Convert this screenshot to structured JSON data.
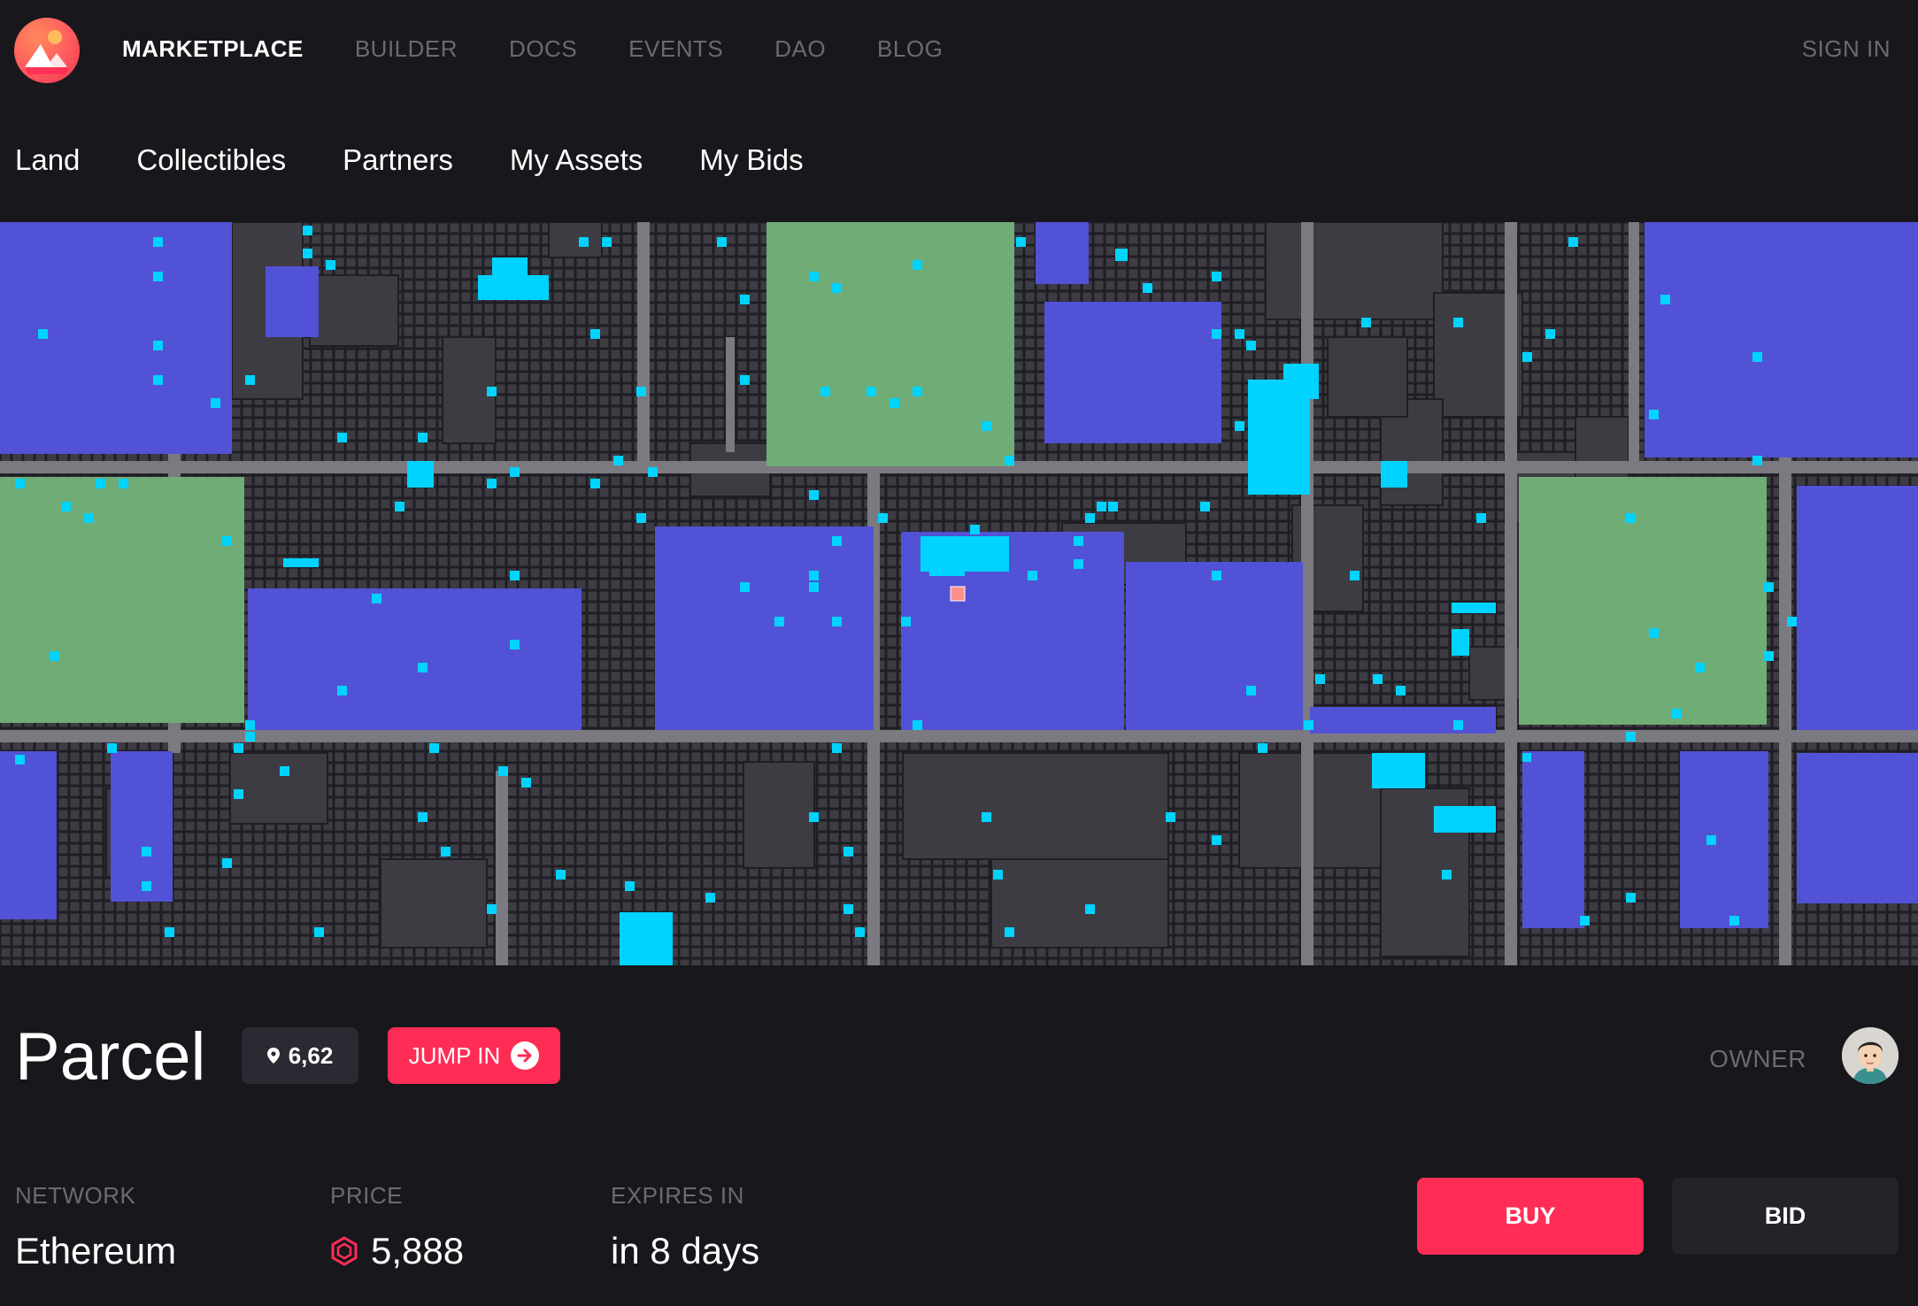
{
  "colors": {
    "accent": "#ff2d55",
    "background": "#18171c",
    "muted_text": "#6b6a74",
    "map_road": "#7b7a80",
    "map_plaza": "#6fac76",
    "map_district": "#5252d6",
    "map_owned": "#00d3ff",
    "map_parcel": "#3d3c43",
    "map_selected": "#ff8f8f"
  },
  "topnav": {
    "items": [
      "MARKETPLACE",
      "BUILDER",
      "DOCS",
      "EVENTS",
      "DAO",
      "BLOG"
    ],
    "active": "MARKETPLACE",
    "sign_in": "SIGN IN"
  },
  "subnav": {
    "items": [
      "Land",
      "Collectibles",
      "Partners",
      "My Assets",
      "My Bids"
    ]
  },
  "parcel": {
    "title": "Parcel",
    "coordinates": "6,62",
    "jump_in_label": "JUMP IN",
    "owner_label": "OWNER"
  },
  "details": {
    "network_label": "NETWORK",
    "network_value": "Ethereum",
    "price_label": "PRICE",
    "price_value": "5,888",
    "expires_label": "EXPIRES IN",
    "expires_value": "in 8 days"
  },
  "actions": {
    "buy_label": "BUY",
    "bid_label": "BID"
  },
  "icons": {
    "logo": "decentraland-logo",
    "pin": "map-pin-icon",
    "jump": "arrow-right-circle-icon",
    "currency": "mana-icon"
  }
}
